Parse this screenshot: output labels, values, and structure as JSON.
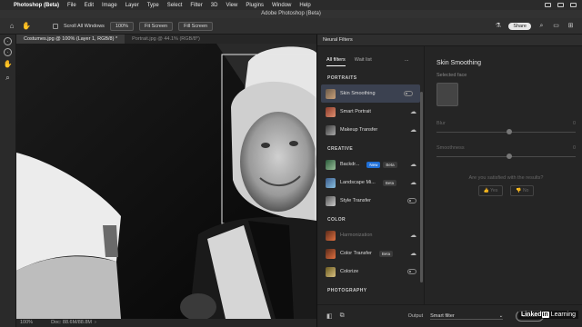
{
  "menubar": {
    "app": "Photoshop (Beta)",
    "items": [
      "File",
      "Edit",
      "Image",
      "Layer",
      "Type",
      "Select",
      "Filter",
      "3D",
      "View",
      "Plugins",
      "Window",
      "Help"
    ]
  },
  "window_title": "Adobe Photoshop (Beta)",
  "options": {
    "scroll_all_windows": "Scroll All Windows",
    "zoom": "100%",
    "fit_screen": "Fit Screen",
    "fill_screen": "Fill Screen",
    "share": "Share"
  },
  "tabs": [
    {
      "label": "Costumes.jpg @ 100% (Layer 1, RGB/8) *",
      "active": true
    },
    {
      "label": "Portrait.jpg @ 44.1% (RGB/8*)",
      "active": false
    }
  ],
  "status": {
    "zoom": "100%",
    "doc": "Doc: 88.6M/88.8M"
  },
  "neural_filters": {
    "title": "Neural Filters",
    "tab_all": "All filters",
    "tab_wait": "Wait list",
    "more": "...",
    "sections": [
      {
        "label": "PORTRAITS",
        "items": [
          {
            "name": "Skin Smoothing",
            "control": "toggle",
            "selected": true
          },
          {
            "name": "Smart Portrait",
            "control": "cloud"
          },
          {
            "name": "Makeup Transfer",
            "control": "cloud"
          }
        ]
      },
      {
        "label": "CREATIVE",
        "items": [
          {
            "name": "Backdr...",
            "badges": [
              "New",
              "Beta"
            ],
            "control": "cloud"
          },
          {
            "name": "Landscape Mi...",
            "badges": [
              "Beta"
            ],
            "control": "cloud"
          },
          {
            "name": "Style Transfer",
            "control": "toggle"
          }
        ]
      },
      {
        "label": "COLOR",
        "items": [
          {
            "name": "Harmonization",
            "control": "cloud",
            "dim": true
          },
          {
            "name": "Color Transfer",
            "badges": [
              "Beta"
            ],
            "control": "cloud"
          },
          {
            "name": "Colorize",
            "control": "toggle"
          }
        ]
      },
      {
        "label": "PHOTOGRAPHY",
        "items": []
      }
    ],
    "settings": {
      "title": "Skin Smoothing",
      "selected_face": "Selected face",
      "blur_label": "Blur",
      "blur_value": "0",
      "smoothness_label": "Smoothness",
      "smoothness_value": "0",
      "question": "Are you satisfied with the results?",
      "yes": "Yes",
      "no": "No"
    },
    "footer": {
      "output_label": "Output",
      "output_value": "Smart filter",
      "cancel": "Cancel"
    }
  },
  "watermark": {
    "in": "in",
    "brand": "Linked",
    "learning": "Learning"
  }
}
